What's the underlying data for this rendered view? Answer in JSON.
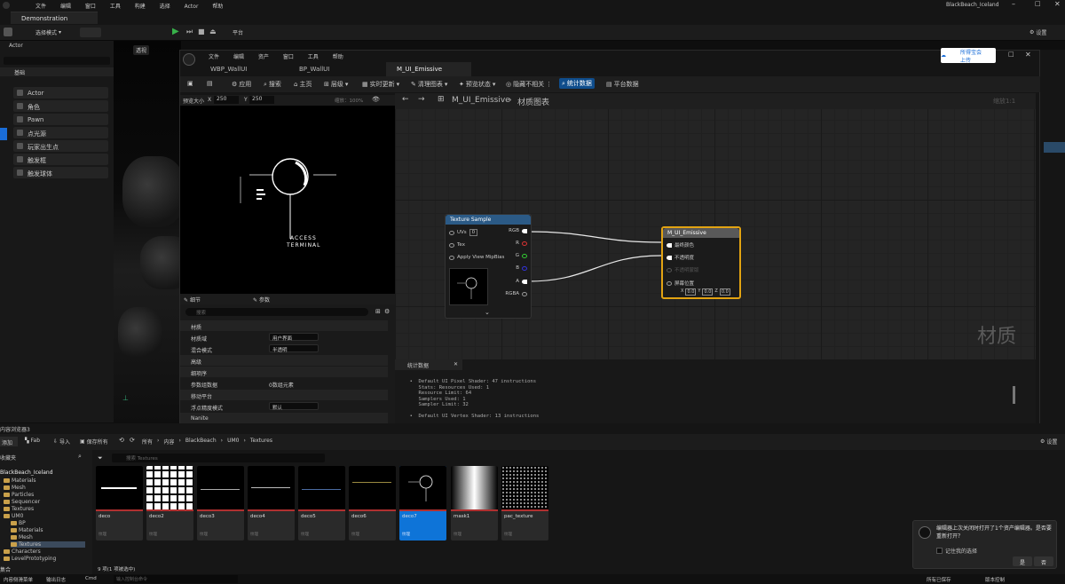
{
  "main": {
    "menu": [
      "文件",
      "编辑",
      "窗口",
      "工具",
      "构建",
      "选择",
      "Actor",
      "帮助"
    ],
    "project_name": "BlackBeach_Iceland",
    "doc_tab": "Demonstration",
    "select_mode": "选择模式",
    "platform": "平台",
    "settings": "设置"
  },
  "left_panel": {
    "title": "Actor",
    "section": "基础",
    "items": [
      "Actor",
      "角色",
      "Pawn",
      "点光源",
      "玩家出生点",
      "触发框",
      "触发球体"
    ]
  },
  "viewport": {
    "perspective": "透视"
  },
  "material_editor": {
    "menu": [
      "文件",
      "编辑",
      "资产",
      "窗口",
      "工具",
      "帮助"
    ],
    "tabs": [
      "WBP_WallUI",
      "BP_WallUI",
      "M_UI_Emissive"
    ],
    "toolbar": [
      "应用",
      "搜索",
      "主页",
      "层级",
      "实时更新",
      "清理图表",
      "预览状态",
      "隐藏不相关",
      "统计数据",
      "平台数据"
    ],
    "upload_button": "所得宝会上传",
    "preview": {
      "size_label": "预览大小",
      "x_label": "X",
      "x_value": "250",
      "y_label": "Y",
      "y_value": "250",
      "zoom": "缩放：100%"
    },
    "preview_text": [
      "ACCESS",
      "TERMINAL"
    ],
    "details": {
      "tabs": [
        "细节",
        "参数"
      ],
      "search_placeholder": "搜索",
      "sections": {
        "material": "材质",
        "advanced": "高级",
        "nanite": "Nanite"
      },
      "rows": [
        {
          "label": "材质域",
          "value": "用户界面"
        },
        {
          "label": "混合模式",
          "value": "半透明"
        },
        {
          "label": "细项序",
          "value": ""
        },
        {
          "label": "参数组数据",
          "value": "0数组元素"
        },
        {
          "label": "移动平台",
          "value": ""
        },
        {
          "label": "浮点精度模式",
          "value": "默认"
        }
      ]
    },
    "graph": {
      "path": "M_UI_Emissive",
      "path_suffix": "材质图表",
      "zoom": "缩放1:1",
      "watermark": "材质",
      "texture_node": {
        "title": "Texture Sample",
        "inputs": [
          "UVs",
          "Tex",
          "Apply View MipBias"
        ],
        "uv_value": "0",
        "outputs": [
          "RGB",
          "R",
          "G",
          "B",
          "A",
          "RGBA"
        ]
      },
      "result_node": {
        "title": "M_UI_Emissive",
        "inputs": [
          "最终颜色",
          "不透明度",
          "不透明蒙版",
          "屏幕位置"
        ],
        "x": "0.0",
        "y": "0.0",
        "z": "0.0"
      }
    },
    "stats": {
      "tab": "统计数据",
      "lines": "  •  Default UI Pixel Shader: 47 instructions\n     Stats: Resources Used: 1\n     Resource Limit: 64\n     Samplers Used: 1\n     Sampler Limit: 32\n\n  •  Default UI Vertex Shader: 13 instructions"
    }
  },
  "content_browser": {
    "title": "内容浏览器3",
    "toolbar": {
      "add": "添加",
      "fab": "Fab",
      "import": "导入",
      "save_all": "保存所有",
      "crumbs": [
        "所有",
        "内容",
        "BlackBeach",
        "UM0",
        "Textures"
      ],
      "settings": "设置"
    },
    "search_placeholder": "搜索 Textures",
    "favorites": "收藏夹",
    "tree_root": "BlackBeach_Iceland",
    "tree": [
      "Materials",
      "Mesh",
      "Particles",
      "Sequencer",
      "Textures",
      "UM0",
      "BP",
      "Materials",
      "Mesh",
      "Textures",
      "Characters",
      "LevelPrototyping"
    ],
    "collections": "集合",
    "assets": [
      {
        "name": "deco",
        "type": "纹理"
      },
      {
        "name": "deco2",
        "type": "纹理"
      },
      {
        "name": "deco3",
        "type": "纹理"
      },
      {
        "name": "deco4",
        "type": "纹理"
      },
      {
        "name": "deco5",
        "type": "纹理"
      },
      {
        "name": "deco6",
        "type": "纹理"
      },
      {
        "name": "deco7",
        "type": "纹理"
      },
      {
        "name": "mask1",
        "type": "纹理"
      },
      {
        "name": "pac_texture",
        "type": "纹理"
      }
    ],
    "status": "9 项(1 项被选中)"
  },
  "bottom": {
    "drawer": "内容侧滑菜单",
    "output_log": "输出日志",
    "cmd": "Cmd",
    "cmd_placeholder": "输入控制台命令",
    "saved": "所有已保存",
    "source_control": "版本控制"
  },
  "toast": {
    "message": "编辑器上次关闭时打开了1个资产编辑器。是否要重新打开？",
    "remember": "记住我的选择",
    "yes": "是",
    "no": "否"
  }
}
